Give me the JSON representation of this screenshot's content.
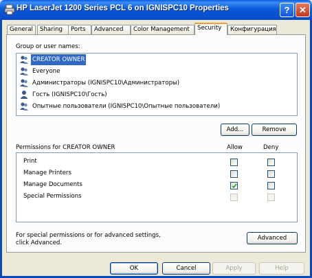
{
  "window": {
    "title": "HP LaserJet 1200 Series PCL 6 on IGNISPC10 Properties",
    "help_label": "?",
    "close_label": "✕"
  },
  "tabs": [
    {
      "label": "General"
    },
    {
      "label": "Sharing"
    },
    {
      "label": "Ports"
    },
    {
      "label": "Advanced"
    },
    {
      "label": "Color Management"
    },
    {
      "label": "Security",
      "active": true
    },
    {
      "label": "Конфигурация"
    }
  ],
  "security": {
    "group_label": "Group or user names:",
    "users": [
      {
        "name": "CREATOR OWNER",
        "selected": true
      },
      {
        "name": "Everyone"
      },
      {
        "name": "Администраторы (IGNISPC10\\Администраторы)"
      },
      {
        "name": "Гость (IGNISPC10\\Гость)"
      },
      {
        "name": "Опытные пользователи (IGNISPC10\\Опытные пользователи)"
      }
    ],
    "add_button": "Add...",
    "remove_button": "Remove",
    "permissions_label": "Permissions for CREATOR OWNER",
    "allow_header": "Allow",
    "deny_header": "Deny",
    "permissions": [
      {
        "name": "Print",
        "allow": false,
        "deny": false,
        "disabled": false
      },
      {
        "name": "Manage Printers",
        "allow": false,
        "deny": false,
        "disabled": false
      },
      {
        "name": "Manage Documents",
        "allow": true,
        "deny": false,
        "disabled": false
      },
      {
        "name": "Special Permissions",
        "allow": false,
        "deny": false,
        "disabled": true
      }
    ],
    "advanced_hint": "For special permissions or for advanced settings, click Advanced.",
    "advanced_button": "Advanced"
  },
  "footer": {
    "ok": "OK",
    "cancel": "Cancel",
    "apply": "Apply",
    "help": "Help"
  },
  "colors": {
    "selection": "#316ac5",
    "titlebar": "#0a5cdf",
    "checkmark": "#21a121"
  }
}
